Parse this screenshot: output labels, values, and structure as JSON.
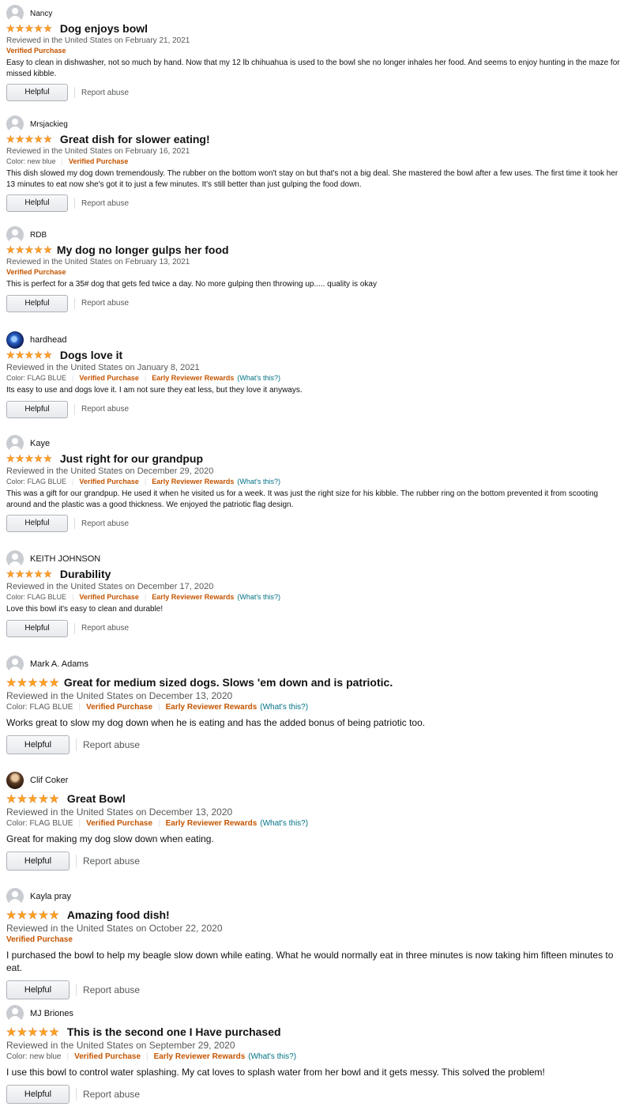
{
  "labels": {
    "helpful": "Helpful",
    "report": "Report abuse",
    "verified": "Verified Purchase",
    "early": "Early Reviewer Rewards",
    "whats": "(What's this?)"
  },
  "reviews": [
    {
      "name": "Nancy",
      "stars": 5,
      "title": "Dog enjoys bowl",
      "date": "Reviewed in the United States on February 21, 2021",
      "text": "Easy to clean in dishwasher, not so much by hand. Now that my 12 lb chihuahua is used to the bowl she no longer inhales her food. And seems to enjoy hunting in the maze for missed kibble."
    },
    {
      "name": "Mrsjackieg",
      "stars": 5,
      "title": "Great dish for slower eating!",
      "date": "Reviewed in the United States on February 16, 2021",
      "color": "Color: new blue",
      "text": "This dish slowed my dog down tremendously. The rubber on the bottom won't stay on but that's not a big deal. She mastered the bowl after a few uses. The first time it took her 13 minutes to eat now she's got it to just a few minutes. It's still better than just gulping the food down."
    },
    {
      "name": "RDB",
      "stars": 5,
      "title": "My dog no longer gulps her food",
      "date": "Reviewed in the United States on February 13, 2021",
      "text": "This is perfect for a 35# dog that gets fed twice a day. No more gulping then throwing up..... quality is okay"
    },
    {
      "name": "hardhead",
      "stars": 5,
      "title": "Dogs love it",
      "date": "Reviewed in the United States on January 8, 2021",
      "color": "Color: FLAG BLUE",
      "text": "Its easy to use and dogs love it. I am not sure they eat less, but they love it anyways."
    },
    {
      "name": "Kaye",
      "stars": 5,
      "title": "Just right for our grandpup",
      "date": "Reviewed in the United States on December 29, 2020",
      "color": "Color: FLAG BLUE",
      "text": "This was a gift for our grandpup. He used it when he visited us for a week. It was just the right size for his kibble. The rubber ring on the bottom prevented it from scooting around and the plastic was a good thickness. We enjoyed the patriotic flag design."
    },
    {
      "name": "KEITH JOHNSON",
      "stars": 5,
      "title": "Durability",
      "date": "Reviewed in the United States on December 17, 2020",
      "color": "Color: FLAG BLUE",
      "text": "Love this bowl it's easy to clean and durable!"
    },
    {
      "name": "Mark A. Adams",
      "stars": 5,
      "title": "Great for medium sized dogs. Slows 'em down and is patriotic.",
      "date": "Reviewed in the United States on December 13, 2020",
      "color": "Color: FLAG BLUE",
      "text": "Works great to slow my dog down when he is eating and has the added bonus of being patriotic too."
    },
    {
      "name": "Clif Coker",
      "stars": 5,
      "title": "Great Bowl",
      "date": "Reviewed in the United States on December 13, 2020",
      "color": "Color: FLAG BLUE",
      "text": "Great for making my dog slow down when eating."
    },
    {
      "name": "Kayla pray",
      "stars": 5,
      "title": "Amazing food dish!",
      "date": "Reviewed in the United States on October 22, 2020",
      "text": "I purchased the bowl to help my beagle slow down while eating. What he would normally eat in three minutes is now taking him fifteen minutes to eat."
    },
    {
      "name": "MJ Briones",
      "stars": 5,
      "title": "This is the second one I Have purchased",
      "date": "Reviewed in the United States on September 29, 2020",
      "color": "Color: new blue",
      "text": "I use this bowl to control water splashing. My cat loves to splash water from her bowl and it gets messy. This solved the problem!"
    }
  ]
}
